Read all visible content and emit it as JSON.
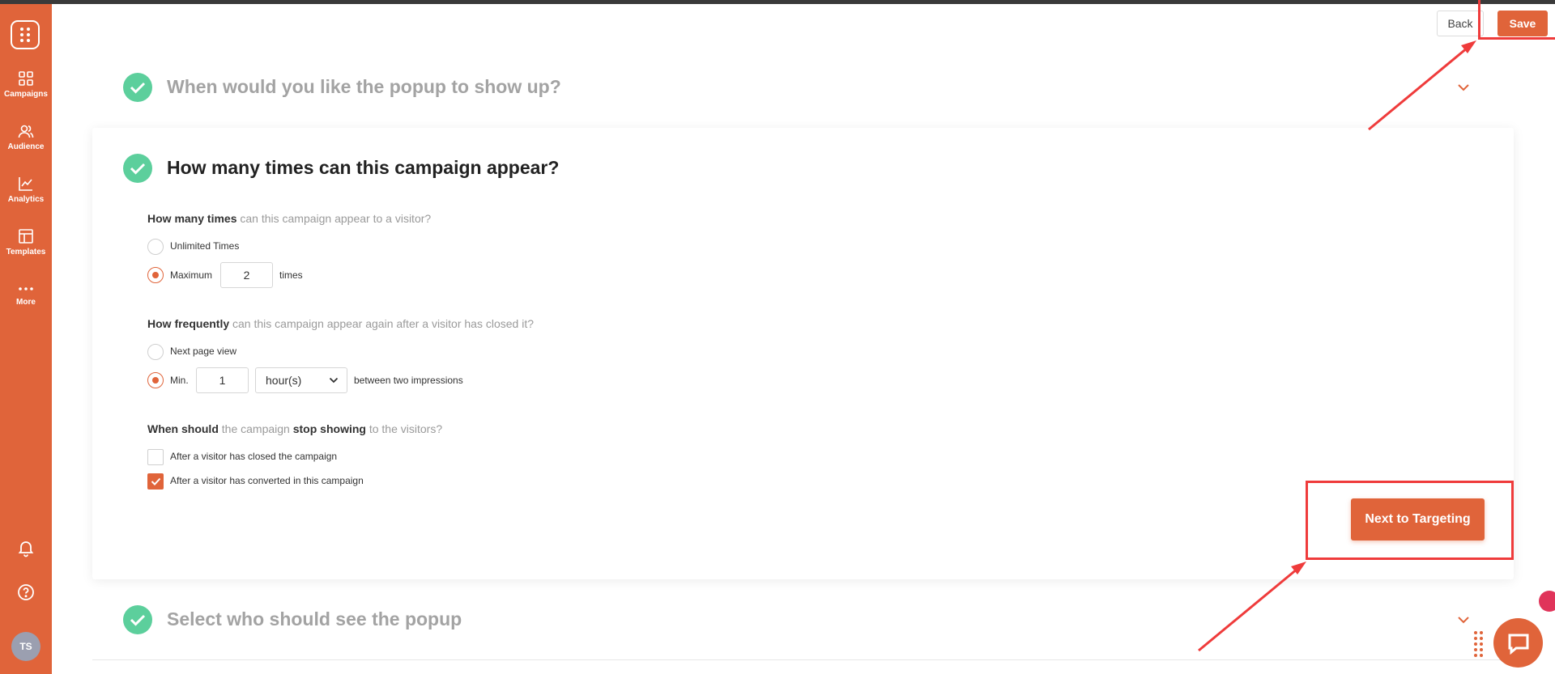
{
  "sidebar": {
    "items": [
      {
        "label": "Campaigns",
        "icon": "grid-icon"
      },
      {
        "label": "Audience",
        "icon": "users-icon"
      },
      {
        "label": "Analytics",
        "icon": "line-chart-icon"
      },
      {
        "label": "Templates",
        "icon": "layout-icon"
      },
      {
        "label": "More",
        "icon": "more-icon"
      }
    ],
    "avatar": "TS"
  },
  "header": {
    "back_label": "Back",
    "save_label": "Save"
  },
  "sections": {
    "show_up": "When would you like the popup to show up?",
    "frequency": "How many times can this campaign appear?",
    "audience": "Select who should see the popup"
  },
  "frequency": {
    "q1_bold": "How many times",
    "q1_rest": " can this campaign appear to a visitor?",
    "opt_unlimited": "Unlimited Times",
    "opt_maximum": "Maximum",
    "max_value": "2",
    "times_label": "times",
    "q2_bold": "How frequently",
    "q2_rest": " can this campaign appear again after a visitor has closed it?",
    "opt_next_page": "Next page view",
    "opt_min": "Min.",
    "min_value": "1",
    "unit_selected": "hour(s)",
    "between_label": "between two impressions",
    "q3_bold1": "When should",
    "q3_mid": " the campaign ",
    "q3_bold2": "stop showing",
    "q3_rest": " to the visitors?",
    "opt_closed": "After a visitor has closed the campaign",
    "opt_converted": "After a visitor has converted in this campaign",
    "next_label": "Next to Targeting"
  },
  "colors": {
    "brand": "#e0643a",
    "success": "#5ccf9c",
    "highlight": "#ef3b3b"
  }
}
